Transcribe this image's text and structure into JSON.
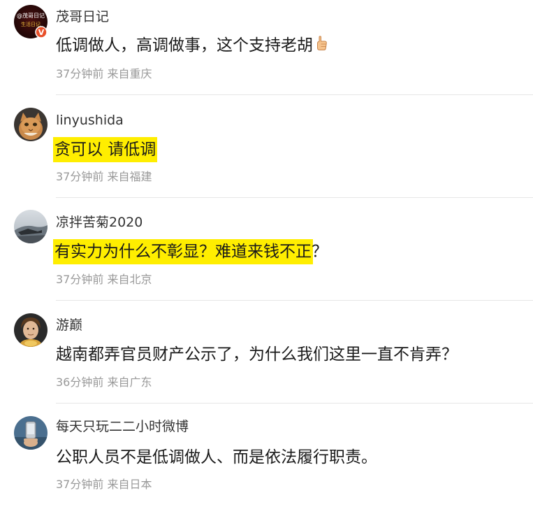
{
  "comments": [
    {
      "username": "茂哥日记",
      "avatar_text": "@茂哥日记",
      "avatar_subtext": "生活日记",
      "avatar_badge": "V",
      "text": "低调做人，高调做事，这个支持老胡",
      "emoji": "thumbs-up-icon",
      "time": "37分钟前",
      "location": "来自重庆",
      "highlighted": false
    },
    {
      "username": "linyushida",
      "text": "贪可以 请低调",
      "time": "37分钟前",
      "location": "来自福建",
      "highlighted": true
    },
    {
      "username": "凉拌苦菊2020",
      "text_highlighted": "有实力为什么不彰显？难道来钱不正",
      "text_rest": "？",
      "time": "37分钟前",
      "location": "来自北京",
      "highlighted": true
    },
    {
      "username": "游巅",
      "text": "越南都弄官员财产公示了，为什么我们这里一直不肯弄？",
      "time": "36分钟前",
      "location": "来自广东",
      "highlighted": false
    },
    {
      "username": "每天只玩二二小时微博",
      "text": "公职人员不是低调做人、而是依法履行职责。",
      "time": "37分钟前",
      "location": "来自日本",
      "highlighted": false
    }
  ],
  "colors": {
    "highlight": "#ffee00",
    "username": "#333333",
    "body": "#1a1a1a",
    "meta": "#999999",
    "divider": "#e6e6e6",
    "badge": "#e8502a"
  }
}
